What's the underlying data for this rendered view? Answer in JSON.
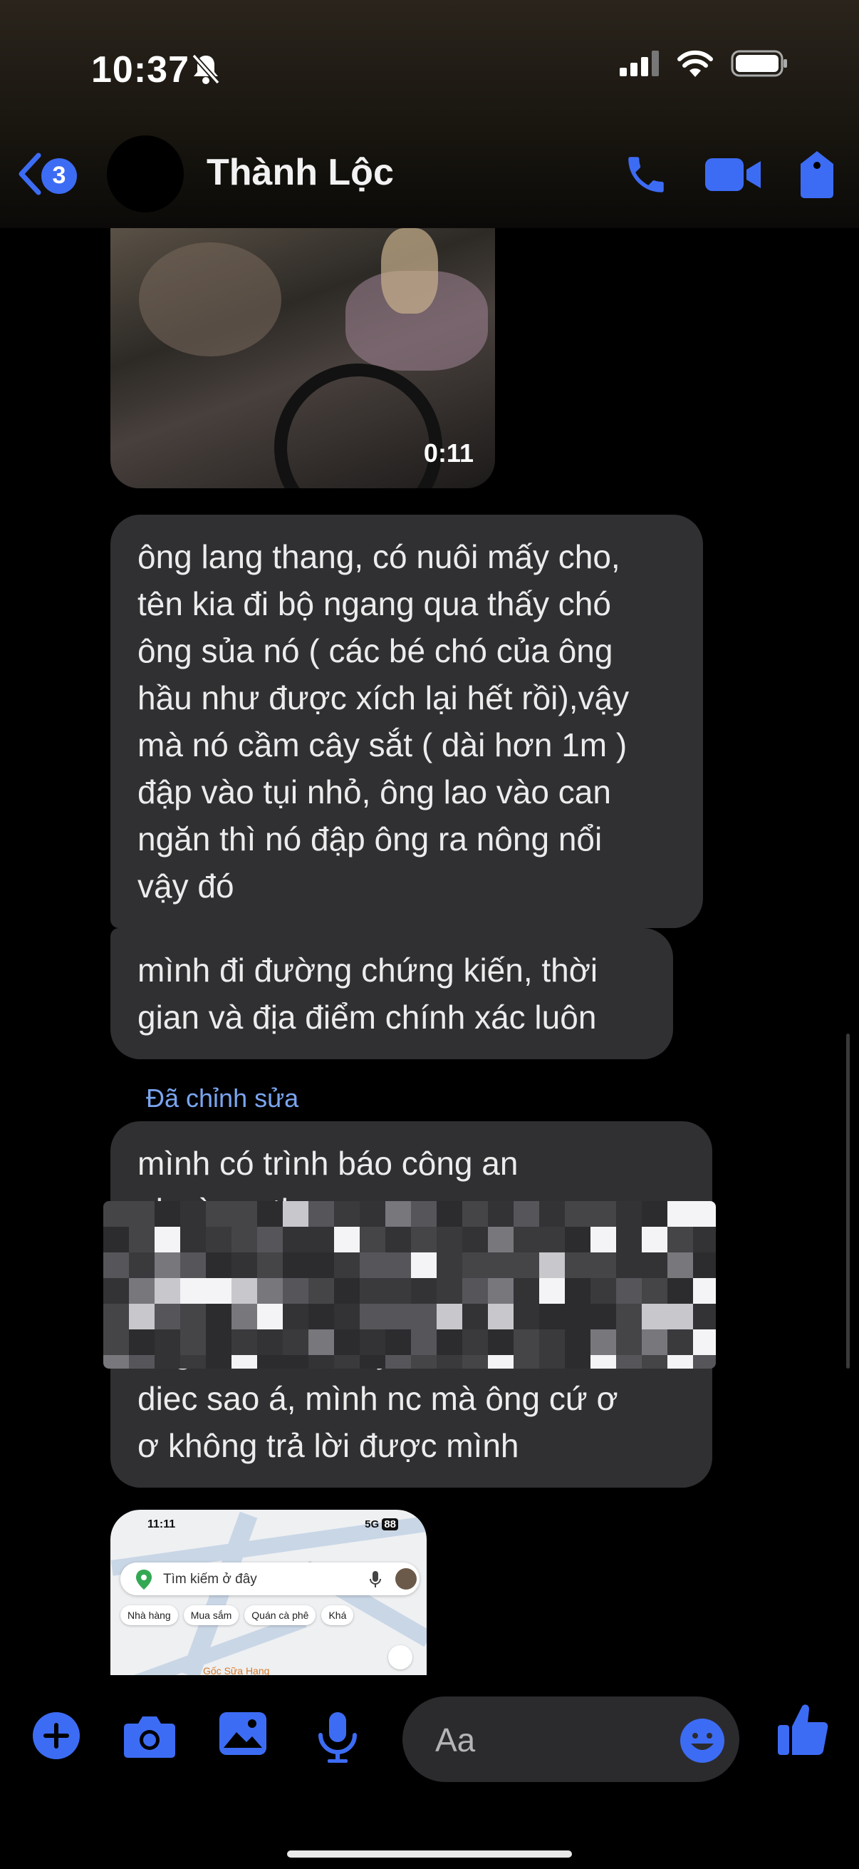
{
  "status_bar": {
    "time": "10:37"
  },
  "header": {
    "back_count": "3",
    "contact_name": "Thành Lộc"
  },
  "video": {
    "duration": "0:11"
  },
  "messages": [
    {
      "text": "ông lang thang, có nuôi mấy cho,\ntên kia đi bộ ngang qua thấy chó\nông sủa nó ( các bé chó của ông\nhầu như được xích lại hết rồi),vậy\nmà nó cầm cây sắt ( dài hơn 1m )\nđập vào tụi nhỏ, ông lao vào can\nngăn thì nó đập ông ra nông nổi\nvậy đó"
    },
    {
      "text": "mình đi đường chứng kiến, thời\ngian và địa điểm chính xác luôn"
    },
    {
      "edited_label": "Đã chỉnh sửa",
      "text": "mình có trình báo công an\nphường, th\n\n\nong kieu bị lu hay bị câm\ndiec sao á, mình nc mà ông cứ ơ\nơ không trả lời được mình"
    }
  ],
  "map_screenshot": {
    "time": "11:11",
    "network": "5G",
    "battery": "88",
    "search_placeholder": "Tìm kiếm ở đây",
    "chips": [
      "Nhà hàng",
      "Mua sắm",
      "Quán cà phê",
      "Khá"
    ],
    "place": "Gốc Sữa Hạng"
  },
  "composer": {
    "placeholder": "Aa"
  },
  "colors": {
    "accent": "#3d6cf4",
    "bubble": "#303033",
    "edited": "#7aa5ef"
  }
}
